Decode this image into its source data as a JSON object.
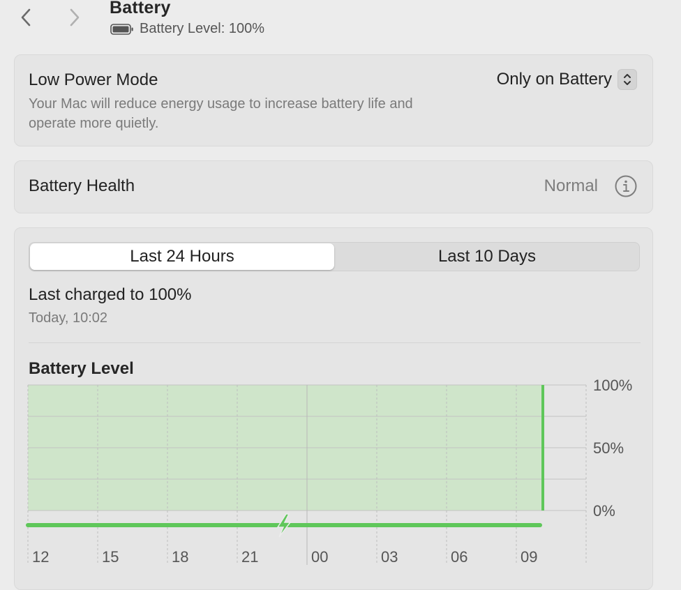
{
  "header": {
    "title": "Battery",
    "battery_level_text": "Battery Level: 100%"
  },
  "low_power_mode": {
    "label": "Low Power Mode",
    "description": "Your Mac will reduce energy usage to increase battery life and operate more quietly.",
    "selected_option": "Only on Battery"
  },
  "battery_health": {
    "label": "Battery Health",
    "value": "Normal"
  },
  "usage": {
    "tabs": [
      "Last 24 Hours",
      "Last 10 Days"
    ],
    "active_tab": "Last 24 Hours",
    "last_charged_title": "Last charged to 100%",
    "last_charged_time": "Today, 10:02"
  },
  "colors": {
    "level_fill": "#cfe5ca",
    "level_line": "#5fc75a",
    "charging_bar": "#5fc75a"
  },
  "chart_data": {
    "type": "area",
    "title": "Battery Level",
    "x_ticks": [
      "12",
      "15",
      "18",
      "21",
      "00",
      "03",
      "06",
      "09"
    ],
    "y_ticks": [
      "100%",
      "50%",
      "0%"
    ],
    "ylim": [
      0,
      100
    ],
    "series": [
      {
        "values": [
          100,
          100,
          100,
          100,
          100,
          100,
          100,
          100
        ]
      }
    ],
    "charging": true,
    "grid": true
  }
}
